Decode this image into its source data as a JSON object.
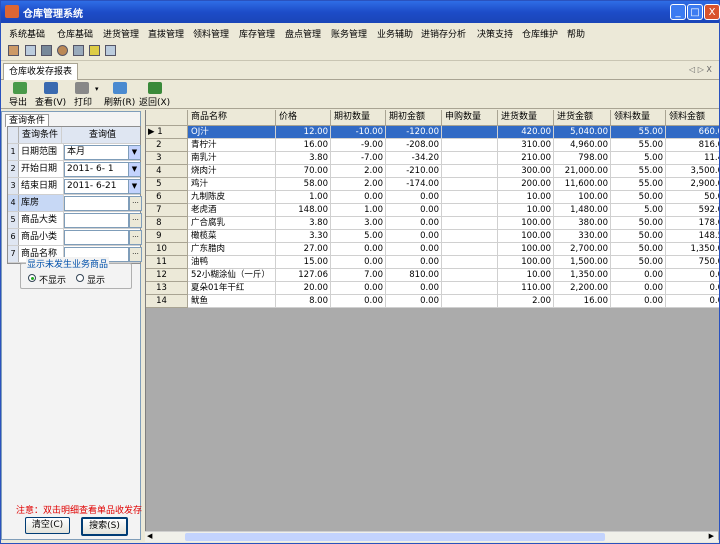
{
  "window": {
    "title": "仓库管理系统",
    "minimize": "_",
    "maximize": "□",
    "close": "X"
  },
  "menu": [
    "系统基础",
    "仓库基础",
    "进货管理",
    "直拨管理",
    "领料管理",
    "库存管理",
    "盘点管理",
    "账务管理",
    "业务辅助",
    "进销存分析",
    "决策支持",
    "仓库维护",
    "帮助"
  ],
  "tab": {
    "label": "仓库收发存报表",
    "nav": "◁ ▷ X"
  },
  "toolbar": {
    "export": "导出",
    "view": "查看(V)",
    "print": "打印",
    "refresh": "刷新(R)",
    "back": "返回(X)"
  },
  "query_panel": {
    "tab_label": "查询条件",
    "header": {
      "condition": "查询条件",
      "value": "查询值"
    },
    "rows": [
      {
        "num": "1",
        "label": "日期范围",
        "value": "本月"
      },
      {
        "num": "2",
        "label": "开始日期",
        "value": "2011- 6- 1"
      },
      {
        "num": "3",
        "label": "结束日期",
        "value": "2011- 6-21"
      },
      {
        "num": "4",
        "label": "库房",
        "value": ""
      },
      {
        "num": "5",
        "label": "商品大类",
        "value": ""
      },
      {
        "num": "6",
        "label": "商品小类",
        "value": ""
      },
      {
        "num": "7",
        "label": "商品名称",
        "value": ""
      }
    ],
    "group_label": "显示未发生业务商品",
    "radio_hide": "不显示",
    "radio_show": "显示",
    "note": "注意：双击明细查看单品收发存",
    "clear_button": "清空(C)",
    "search_button": "搜索(S)"
  },
  "grid": {
    "columns": [
      "商品名称",
      "价格",
      "期初数量",
      "期初金额",
      "申购数量",
      "进货数量",
      "进货金额",
      "领料数量",
      "领料金额"
    ],
    "rows": [
      [
        "1",
        "OJ汁",
        "12.00",
        "-10.00",
        "-120.00",
        "",
        "420.00",
        "5,040.00",
        "55.00",
        "660.0"
      ],
      [
        "2",
        "青柠汁",
        "16.00",
        "-9.00",
        "-208.00",
        "",
        "310.00",
        "4,960.00",
        "55.00",
        "816.0"
      ],
      [
        "3",
        "南乳汁",
        "3.80",
        "-7.00",
        "-34.20",
        "",
        "210.00",
        "798.00",
        "5.00",
        "11.4"
      ],
      [
        "4",
        "烧肉汁",
        "70.00",
        "2.00",
        "-210.00",
        "",
        "300.00",
        "21,000.00",
        "55.00",
        "3,500.0"
      ],
      [
        "5",
        "鸡汁",
        "58.00",
        "2.00",
        "-174.00",
        "",
        "200.00",
        "11,600.00",
        "55.00",
        "2,900.0"
      ],
      [
        "6",
        "九制陈皮",
        "1.00",
        "0.00",
        "0.00",
        "",
        "10.00",
        "100.00",
        "50.00",
        "50.0"
      ],
      [
        "7",
        "老虎酒",
        "148.00",
        "1.00",
        "0.00",
        "",
        "10.00",
        "1,480.00",
        "5.00",
        "592.0"
      ],
      [
        "8",
        "广合腐乳",
        "3.80",
        "3.00",
        "0.00",
        "",
        "100.00",
        "380.00",
        "50.00",
        "178.6"
      ],
      [
        "9",
        "橄榄菜",
        "3.30",
        "5.00",
        "0.00",
        "",
        "100.00",
        "330.00",
        "50.00",
        "148.5"
      ],
      [
        "10",
        "广东腊肉",
        "27.00",
        "0.00",
        "0.00",
        "",
        "100.00",
        "2,700.00",
        "50.00",
        "1,350.0"
      ],
      [
        "11",
        "油鸭",
        "15.00",
        "0.00",
        "0.00",
        "",
        "100.00",
        "1,500.00",
        "50.00",
        "750.0"
      ],
      [
        "12",
        "52小糊涂仙（一斤）",
        "127.06",
        "7.00",
        "810.00",
        "",
        "10.00",
        "1,350.00",
        "0.00",
        "0.0"
      ],
      [
        "13",
        "夏朵01年干红",
        "20.00",
        "0.00",
        "0.00",
        "",
        "110.00",
        "2,200.00",
        "0.00",
        "0.0"
      ],
      [
        "14",
        "鱿鱼",
        "8.00",
        "0.00",
        "0.00",
        "",
        "2.00",
        "16.00",
        "0.00",
        "0.0"
      ]
    ]
  }
}
